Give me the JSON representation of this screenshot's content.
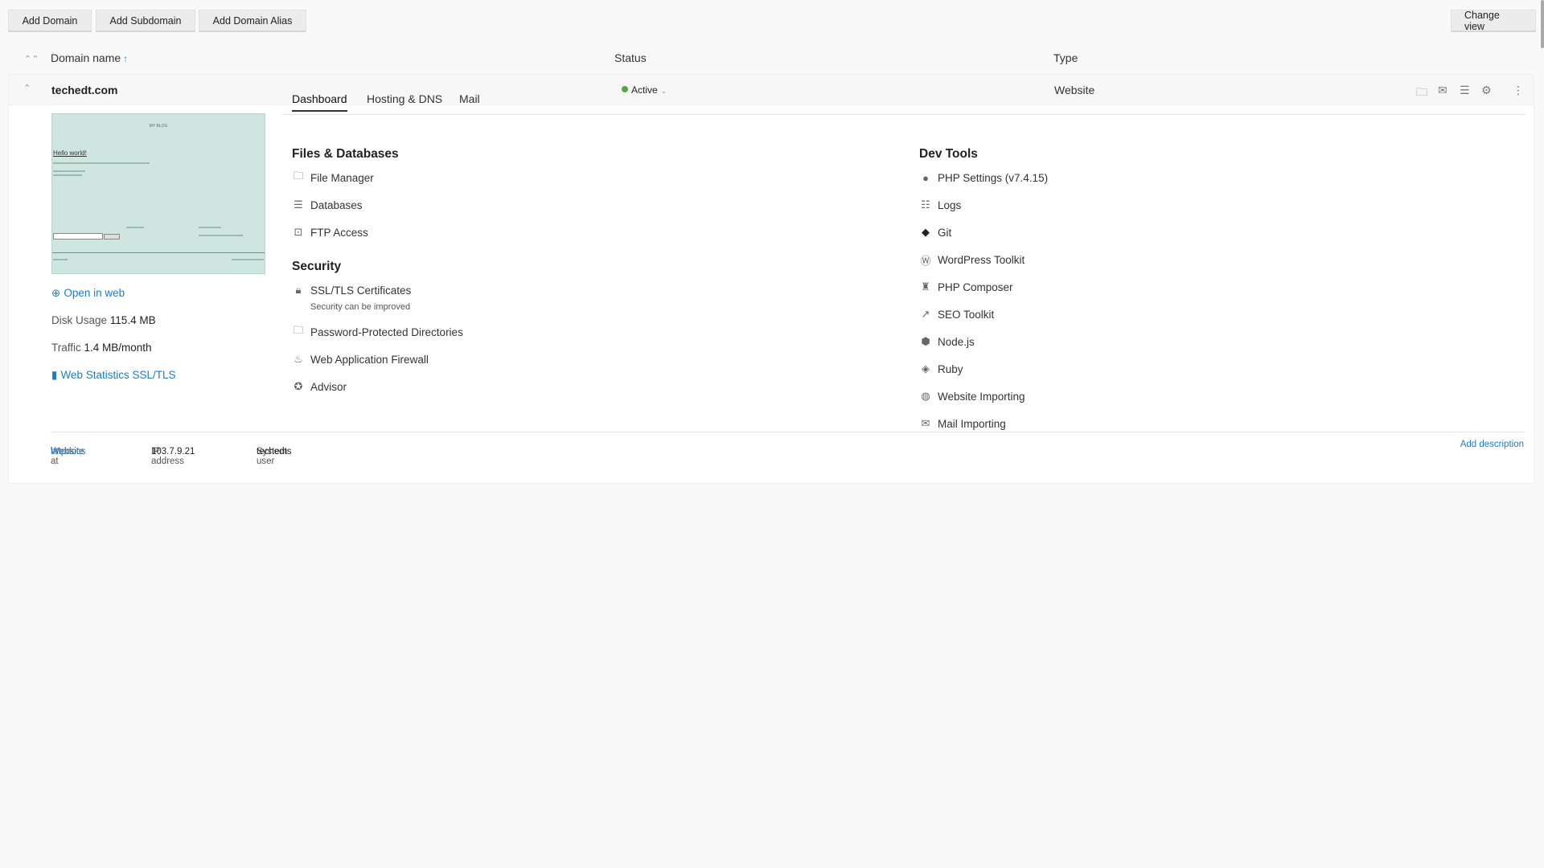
{
  "toolbar": {
    "add_domain": "Add Domain",
    "add_subdomain": "Add Subdomain",
    "add_domain_alias": "Add Domain Alias",
    "change_view": "Change view"
  },
  "table": {
    "col_domain": "Domain name",
    "col_status": "Status",
    "col_type": "Type",
    "sort_arrow": "↑"
  },
  "domain": {
    "name": "techedt.com",
    "status": "Active",
    "type": "Website",
    "status_color": "#52a844"
  },
  "preview": {
    "site_title": "MY BLOG",
    "heading": "Hello world!"
  },
  "sidebar": {
    "open_in_web": "Open in web",
    "disk_usage_label": "Disk Usage",
    "disk_usage_value": "115.4 MB",
    "traffic_label": "Traffic",
    "traffic_value": "1.4 MB/month",
    "web_stats": "Web Statistics SSL/TLS"
  },
  "tabs": [
    "Dashboard",
    "Hosting & DNS",
    "Mail"
  ],
  "files_databases": {
    "title": "Files & Databases",
    "items": [
      "File Manager",
      "Databases",
      "FTP Access"
    ]
  },
  "security": {
    "title": "Security",
    "ssl": "SSL/TLS Certificates",
    "ssl_sub": "Security can be improved",
    "items": [
      "Password-Protected Directories",
      "Web Application Firewall",
      "Advisor"
    ]
  },
  "dev_tools": {
    "title": "Dev Tools",
    "items": [
      "PHP Settings (v7.4.15)",
      "Logs",
      "Git",
      "WordPress Toolkit",
      "PHP Composer",
      "SEO Toolkit",
      "Node.js",
      "Ruby",
      "Website Importing",
      "Mail Importing"
    ]
  },
  "footer": {
    "website_at_label": "Website at",
    "website_at_value": "httpdocs",
    "ip_label": "IP address",
    "ip_value": "103.7.9.21",
    "user_label": "System user",
    "user_value": "techedts",
    "add_description": "Add description"
  },
  "colors": {
    "link": "#1e7bc7",
    "accent_active": "#52a844",
    "preview_bg": "#cfe6e0"
  }
}
